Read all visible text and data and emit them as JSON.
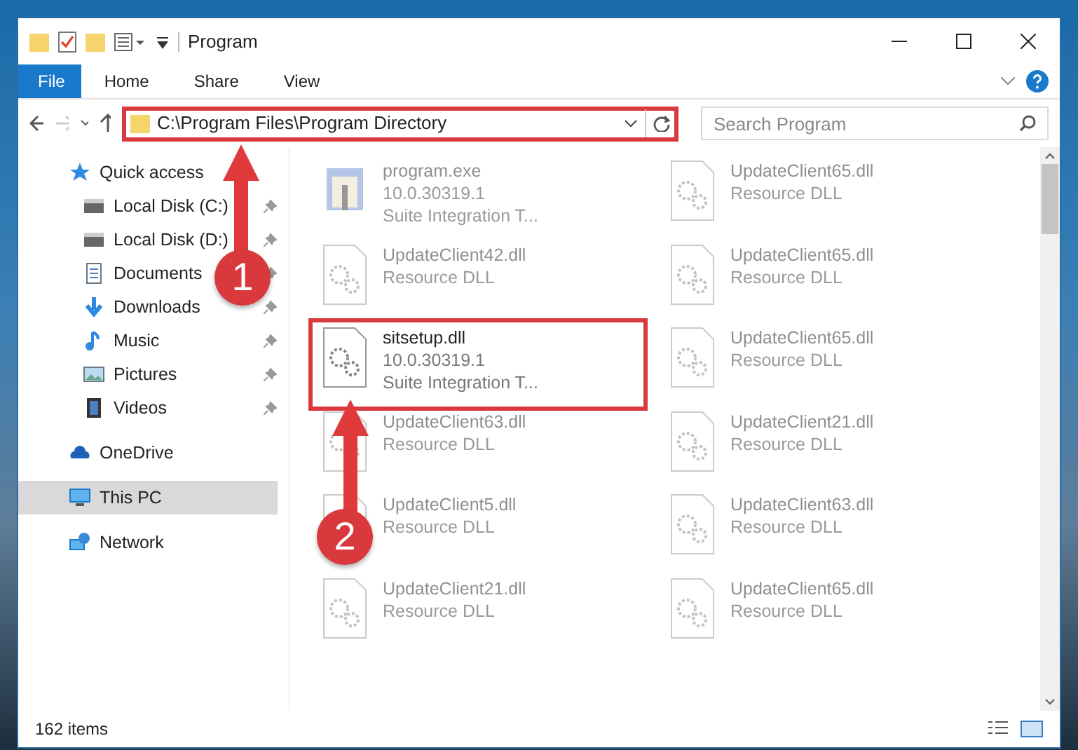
{
  "window": {
    "title": "Program"
  },
  "ribbon_tabs": [
    {
      "label": "File",
      "selected": true
    },
    {
      "label": "Home",
      "selected": false
    },
    {
      "label": "Share",
      "selected": false
    },
    {
      "label": "View",
      "selected": false
    }
  ],
  "address_bar": {
    "path": "C:\\Program Files\\Program Directory",
    "highlighted": true
  },
  "search": {
    "placeholder": "Search Program"
  },
  "sidebar": {
    "items": [
      {
        "label": "Quick access",
        "kind": "star",
        "selected": false,
        "children": [
          {
            "label": "Local Disk (C:)",
            "kind": "disk",
            "pinned": true
          },
          {
            "label": "Local Disk (D:)",
            "kind": "disk",
            "pinned": true
          },
          {
            "label": "Documents",
            "kind": "docs",
            "pinned": true
          },
          {
            "label": "Downloads",
            "kind": "download",
            "pinned": true
          },
          {
            "label": "Music",
            "kind": "music",
            "pinned": true
          },
          {
            "label": "Pictures",
            "kind": "pictures",
            "pinned": true
          },
          {
            "label": "Videos",
            "kind": "videos",
            "pinned": true
          }
        ]
      },
      {
        "label": "OneDrive",
        "kind": "cloud",
        "selected": false
      },
      {
        "label": "This PC",
        "kind": "pc",
        "selected": true
      },
      {
        "label": "Network",
        "kind": "network",
        "selected": false
      }
    ]
  },
  "files": [
    {
      "name": "program.exe",
      "lines": [
        "10.0.30319.1",
        "Suite Integration T..."
      ],
      "kind": "exe",
      "blurred": true,
      "highlighted": false
    },
    {
      "name": "UpdateClient65.dll",
      "lines": [
        "Resource DLL"
      ],
      "kind": "dll",
      "blurred": true,
      "highlighted": false
    },
    {
      "name": "UpdateClient42.dll",
      "lines": [
        "Resource DLL"
      ],
      "kind": "dll",
      "blurred": true,
      "highlighted": false
    },
    {
      "name": "UpdateClient65.dll",
      "lines": [
        "Resource DLL"
      ],
      "kind": "dll",
      "blurred": true,
      "highlighted": false
    },
    {
      "name": "sitsetup.dll",
      "lines": [
        "10.0.30319.1",
        "Suite Integration T..."
      ],
      "kind": "dll",
      "blurred": false,
      "highlighted": true
    },
    {
      "name": "UpdateClient65.dll",
      "lines": [
        "Resource DLL"
      ],
      "kind": "dll",
      "blurred": true,
      "highlighted": false
    },
    {
      "name": "UpdateClient63.dll",
      "lines": [
        "Resource DLL"
      ],
      "kind": "dll",
      "blurred": true,
      "highlighted": false
    },
    {
      "name": "UpdateClient21.dll",
      "lines": [
        "Resource DLL"
      ],
      "kind": "dll",
      "blurred": true,
      "highlighted": false
    },
    {
      "name": "UpdateClient5.dll",
      "lines": [
        "Resource DLL"
      ],
      "kind": "dll",
      "blurred": true,
      "highlighted": false
    },
    {
      "name": "UpdateClient63.dll",
      "lines": [
        "Resource DLL"
      ],
      "kind": "dll",
      "blurred": true,
      "highlighted": false
    },
    {
      "name": "UpdateClient21.dll",
      "lines": [
        "Resource DLL"
      ],
      "kind": "dll",
      "blurred": true,
      "highlighted": false
    },
    {
      "name": "UpdateClient65.dll",
      "lines": [
        "Resource DLL"
      ],
      "kind": "dll",
      "blurred": true,
      "highlighted": false
    }
  ],
  "status_bar": {
    "count": "162 items"
  },
  "annotations": [
    {
      "label": "1"
    },
    {
      "label": "2"
    }
  ]
}
